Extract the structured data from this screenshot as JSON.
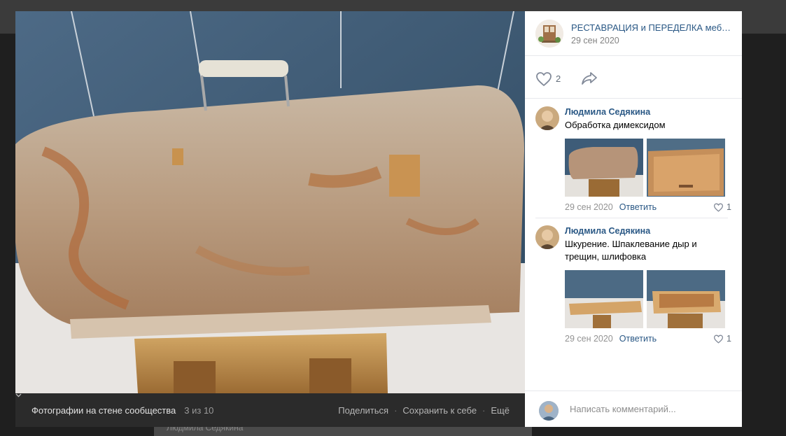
{
  "viewer": {
    "footer_title": "Фотографии на стене сообщества",
    "counter": "3 из 10",
    "share_label": "Поделиться",
    "save_label": "Сохранить к себе",
    "more_label": "Ещё"
  },
  "background_page": {
    "author_hint": "Людмила Седякина"
  },
  "post": {
    "group_name": "РЕСТАВРАЦИЯ и ПЕРЕДЕЛКА мебе…",
    "date": "29 сен 2020",
    "likes": "2"
  },
  "comments": [
    {
      "author": "Людмила Седякина",
      "text": "Обработка димексидом",
      "date": "29 сен 2020",
      "reply_label": "Ответить",
      "likes": "1"
    },
    {
      "author": "Людмила Седякина",
      "text": "Шкурение. Шпаклевание дыр и трещин, шлифовка",
      "date": "29 сен 2020",
      "reply_label": "Ответить",
      "likes": "1"
    }
  ],
  "comment_input": {
    "placeholder": "Написать комментарий..."
  },
  "colors": {
    "link": "#2a5885",
    "footer_bg": "#2b2b2b",
    "panel_bg": "#ffffff"
  }
}
